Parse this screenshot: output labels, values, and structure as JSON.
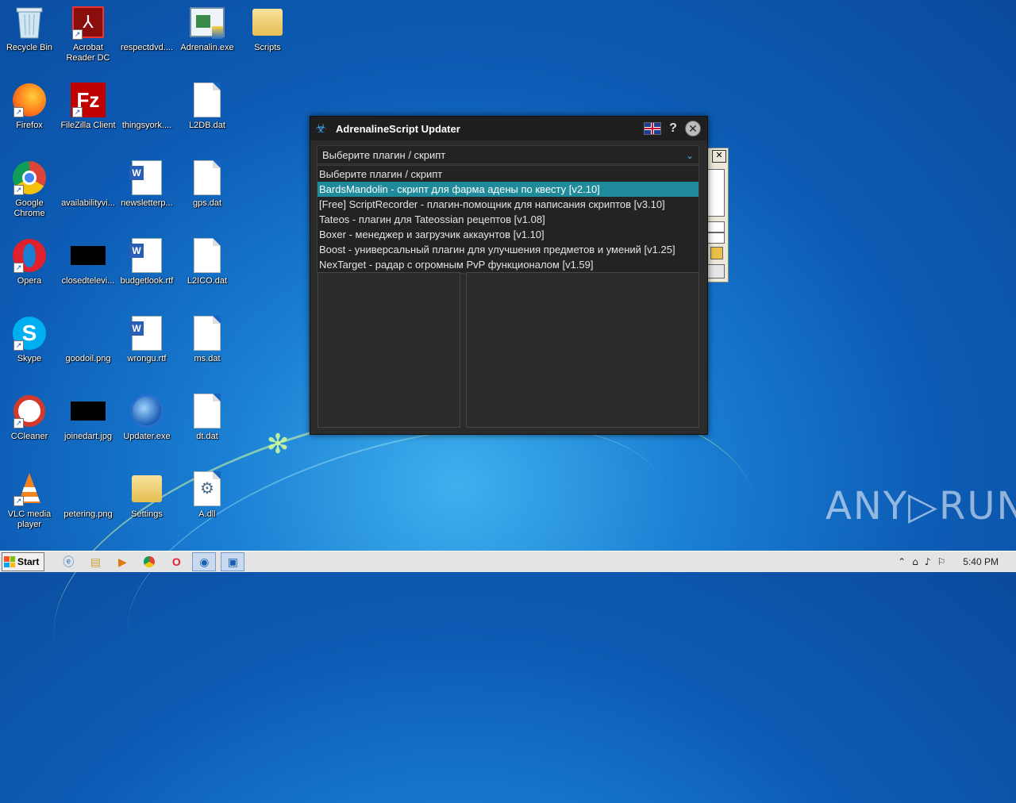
{
  "desktop": {
    "icons": [
      {
        "label": "Recycle Bin"
      },
      {
        "label": "Acrobat Reader DC"
      },
      {
        "label": "respectdvd...."
      },
      {
        "label": "Adrenalin.exe"
      },
      {
        "label": "Scripts"
      },
      {
        "label": "Firefox"
      },
      {
        "label": "FileZilla Client"
      },
      {
        "label": "thingsyork...."
      },
      {
        "label": "L2DB.dat"
      },
      {
        "label": "Google Chrome"
      },
      {
        "label": "availabilityvi..."
      },
      {
        "label": "newsletterp..."
      },
      {
        "label": "gps.dat"
      },
      {
        "label": "Opera"
      },
      {
        "label": "closedtelevi..."
      },
      {
        "label": "budgetlook.rtf"
      },
      {
        "label": "L2ICO.dat"
      },
      {
        "label": "Skype"
      },
      {
        "label": "goodoil.png"
      },
      {
        "label": "wrongu.rtf"
      },
      {
        "label": "ms.dat"
      },
      {
        "label": "CCleaner"
      },
      {
        "label": "joinedart.jpg"
      },
      {
        "label": "Updater.exe"
      },
      {
        "label": "dt.dat"
      },
      {
        "label": "VLC media player"
      },
      {
        "label": "petering.png"
      },
      {
        "label": "Settings"
      },
      {
        "label": "A.dll"
      }
    ]
  },
  "dialog": {
    "title": "AdrenalineScript Updater",
    "help_glyph": "?",
    "close_glyph": "✕",
    "select_value": "Выберите плагин / скрипт",
    "options": [
      "Выберите плагин / скрипт",
      "BardsMandolin - скрипт для фарма адены по квесту [v2.10]",
      "[Free] ScriptRecorder - плагин-помощник для написания скриптов [v3.10]",
      "Tateos - плагин для Tateossian рецептов [v1.08]",
      "Boxer - менеджер и загрузчик аккаунтов [v1.10]",
      "Boost - универсальный плагин для улучшения предметов и умений [v1.25]",
      "NexTarget - радар с огромным PvP функционалом [v1.59]"
    ],
    "selected_index": 1
  },
  "taskbar": {
    "start_label": "Start",
    "clock": "5:40 PM"
  },
  "watermark": "ANY▷RUN",
  "colors": {
    "highlight": "#1f8a99",
    "dialog_bg": "#2b2b2b",
    "titlebar_bg": "#1f1f1f"
  }
}
